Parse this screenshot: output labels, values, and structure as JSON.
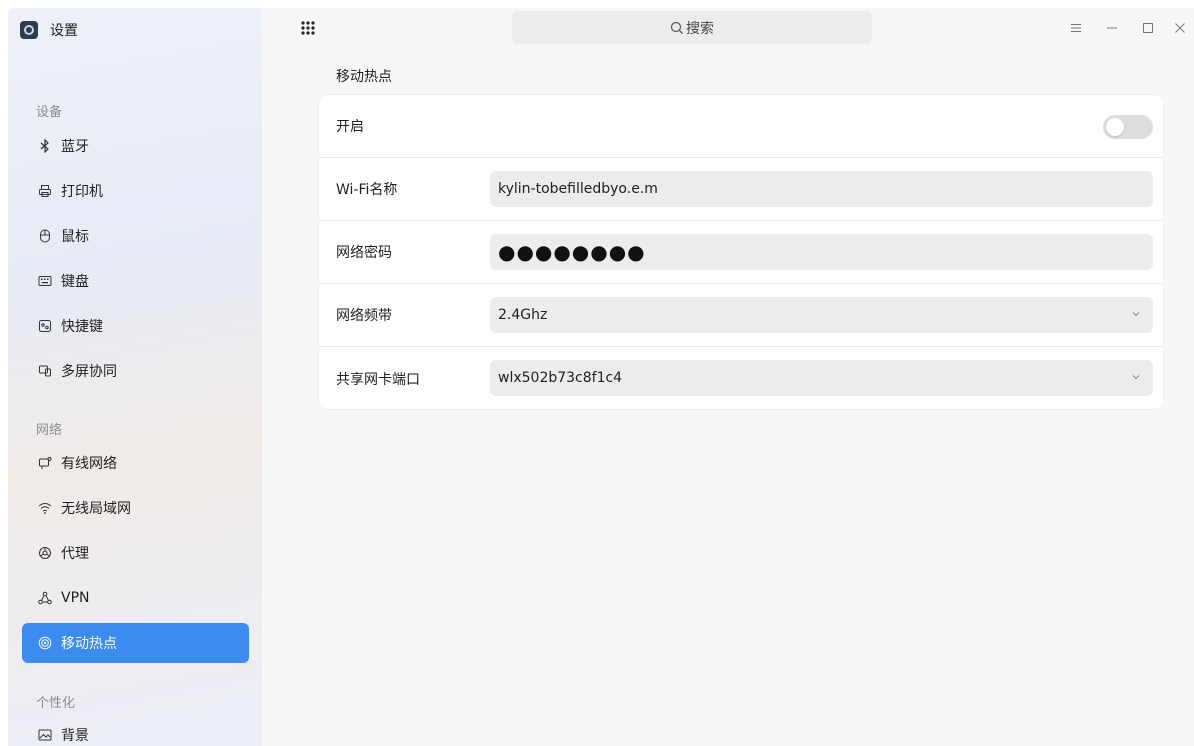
{
  "app": {
    "title": "设置",
    "icon": "settings-app-icon"
  },
  "sidebar": {
    "groups": [
      {
        "title": "设备"
      },
      {
        "title": "网络"
      },
      {
        "title": "个性化"
      }
    ],
    "items": [
      {
        "label": "蓝牙",
        "icon": "bluetooth-icon"
      },
      {
        "label": "打印机",
        "icon": "printer-icon"
      },
      {
        "label": "鼠标",
        "icon": "mouse-icon"
      },
      {
        "label": "键盘",
        "icon": "keyboard-icon"
      },
      {
        "label": "快捷键",
        "icon": "shortcut-icon"
      },
      {
        "label": "多屏协同",
        "icon": "multiscreen-icon"
      },
      {
        "label": "有线网络",
        "icon": "wired-network-icon"
      },
      {
        "label": "无线局域网",
        "icon": "wifi-icon"
      },
      {
        "label": "代理",
        "icon": "proxy-icon"
      },
      {
        "label": "VPN",
        "icon": "vpn-icon"
      },
      {
        "label": "移动热点",
        "icon": "hotspot-icon",
        "active": true
      },
      {
        "label": "背景",
        "icon": "background-icon"
      }
    ]
  },
  "topbar": {
    "search_placeholder": "搜索"
  },
  "main": {
    "section_title": "移动热点",
    "rows": {
      "enable": {
        "label": "开启",
        "checked": false
      },
      "ssid": {
        "label": "Wi-Fi名称",
        "value": "kylin-tobefilledbyo.e.m"
      },
      "password": {
        "label": "网络密码",
        "value": "●●●●●●●●"
      },
      "band": {
        "label": "网络频带",
        "value": "2.4Ghz"
      },
      "iface": {
        "label": "共享网卡端口",
        "value": "wlx502b73c8f1c4"
      }
    }
  },
  "colors": {
    "accent": "#3c8cf0",
    "field_bg": "#ececec",
    "sidebar_bg": "#eef1f8"
  }
}
